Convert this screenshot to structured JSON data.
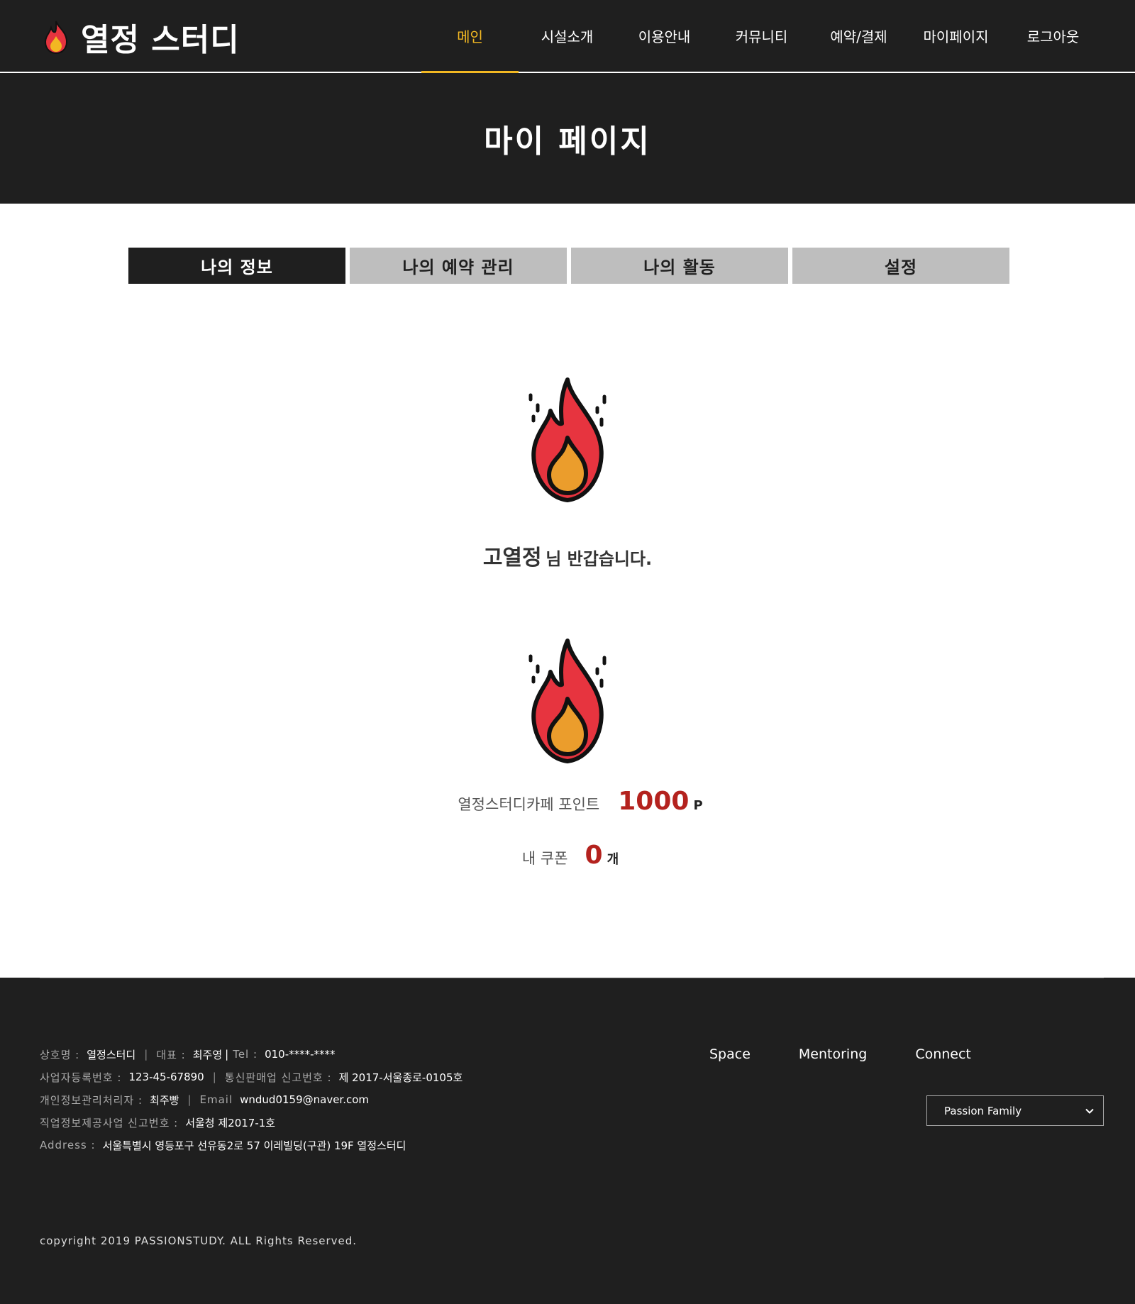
{
  "header": {
    "logo_text": "열정 스터디",
    "logo_icon": "flame-icon",
    "nav": [
      {
        "label": "메인",
        "active": true
      },
      {
        "label": "시설소개",
        "active": false
      },
      {
        "label": "이용안내",
        "active": false
      },
      {
        "label": "커뮤니티",
        "active": false
      },
      {
        "label": "예약/결제",
        "active": false
      },
      {
        "label": "마이페이지",
        "active": false
      },
      {
        "label": "로그아웃",
        "active": false
      }
    ],
    "accent_color": "#f2b822"
  },
  "banner": {
    "title": "마이 페이지"
  },
  "tabs": [
    {
      "label": "나의 정보",
      "active": true
    },
    {
      "label": "나의 예약 관리",
      "active": false
    },
    {
      "label": "나의 활동",
      "active": false
    },
    {
      "label": "설정",
      "active": false
    }
  ],
  "profile": {
    "avatar_icon": "flame-icon",
    "user_name": "고열정",
    "greeting_suffix": "님 반갑습니다."
  },
  "points": {
    "icon": "flame-icon",
    "label": "열정스터디카페 포인트",
    "value": "1000",
    "unit": "P"
  },
  "coupons": {
    "label": "내 쿠폰",
    "value": "0",
    "unit": "개"
  },
  "footer": {
    "company_label": "상호명 :",
    "company_value": "열정스터디",
    "ceo_label": "대표 :",
    "ceo_value": "최주영",
    "tel_label": "Tel :",
    "tel_value": "010-****-****",
    "biz_no_label": "사업자등록번호 :",
    "biz_no_value": "123-45-67890",
    "mail_order_label": "통신판매업 신고번호 :",
    "mail_order_value": "제 2017-서울종로-0105호",
    "privacy_label": "개인정보관리처리자 :",
    "privacy_value": "최주빵",
    "email_label": "Email",
    "email_value": "wndud0159@naver.com",
    "job_label": "직업정보제공사업 신고번호 :",
    "job_value": "서울청 제2017-1호",
    "address_label": "Address :",
    "address_value": "서울특별시 영등포구 선유동2로 57 이레빌딩(구관) 19F 열정스터디",
    "links": [
      "Space",
      "Mentoring",
      "Connect"
    ],
    "family_select": {
      "selected": "Passion Family"
    },
    "copyright": "copyright 2019 PASSIONSTUDY. ALL Rights Reserved."
  },
  "colors": {
    "dark": "#1f1f1f",
    "tab_inactive": "#bebebe",
    "point_red": "#b4221e",
    "flame_red": "#e7343f",
    "flame_orange": "#eb9d2c"
  }
}
